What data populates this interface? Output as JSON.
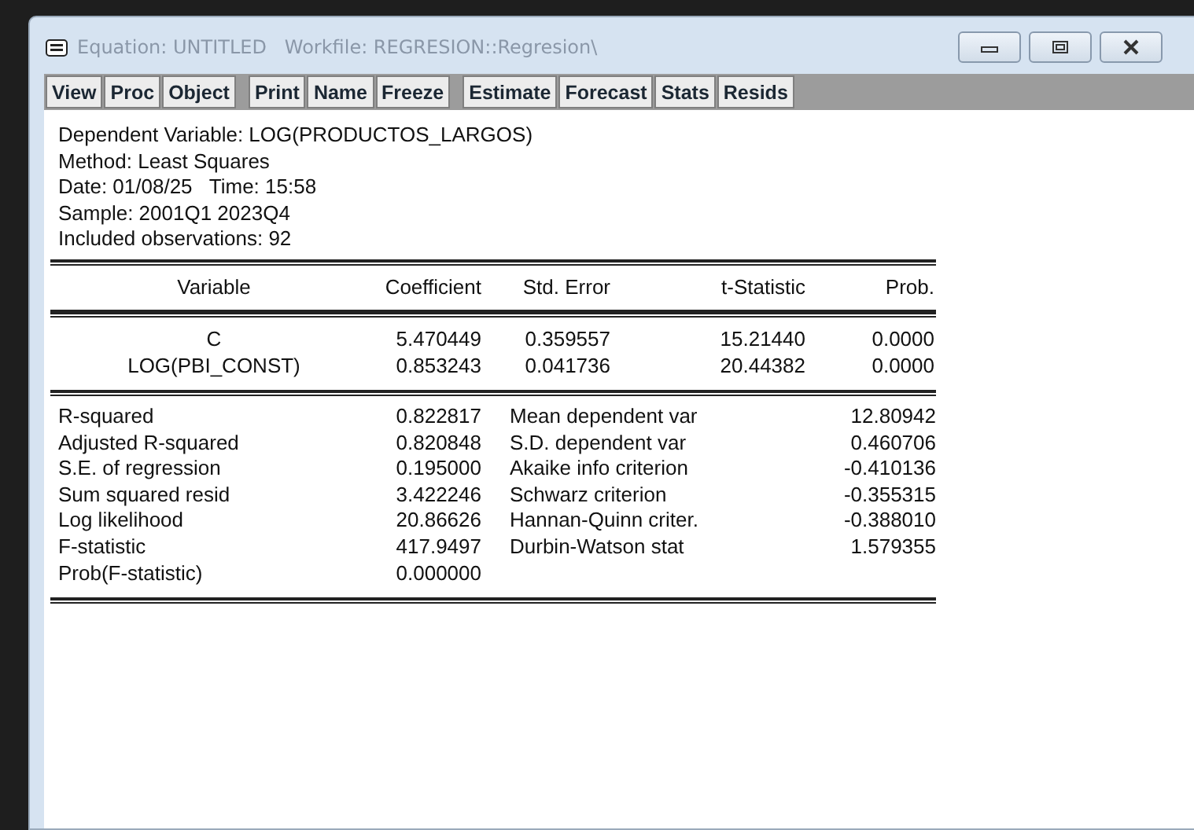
{
  "window": {
    "title": "Equation: UNTITLED   Workfile: REGRESION::Regresion\\"
  },
  "toolbar_groups": [
    [
      "View",
      "Proc",
      "Object"
    ],
    [
      "Print",
      "Name",
      "Freeze"
    ],
    [
      "Estimate",
      "Forecast",
      "Stats",
      "Resids"
    ]
  ],
  "header_lines": [
    "Dependent Variable: LOG(PRODUCTOS_LARGOS)",
    "Method: Least Squares",
    "Date: 01/08/25   Time: 15:58",
    "Sample: 2001Q1 2023Q4",
    "Included observations: 92"
  ],
  "coef_table": {
    "columns": [
      "Variable",
      "Coefficient",
      "Std. Error",
      "t-Statistic",
      "Prob."
    ],
    "rows": [
      [
        "C",
        "5.470449",
        "0.359557",
        "15.21440",
        "0.0000"
      ],
      [
        "LOG(PBI_CONST)",
        "0.853243",
        "0.041736",
        "20.44382",
        "0.0000"
      ]
    ]
  },
  "stats": [
    [
      "R-squared",
      "0.822817",
      "Mean dependent var",
      "12.80942"
    ],
    [
      "Adjusted R-squared",
      "0.820848",
      "S.D. dependent var",
      "0.460706"
    ],
    [
      "S.E. of regression",
      "0.195000",
      "Akaike info criterion",
      "-0.410136"
    ],
    [
      "Sum squared resid",
      "3.422246",
      "Schwarz criterion",
      "-0.355315"
    ],
    [
      "Log likelihood",
      "20.86626",
      "Hannan-Quinn criter.",
      "-0.388010"
    ],
    [
      "F-statistic",
      "417.9497",
      "Durbin-Watson stat",
      "1.579355"
    ],
    [
      "Prob(F-statistic)",
      "0.000000"
    ]
  ]
}
